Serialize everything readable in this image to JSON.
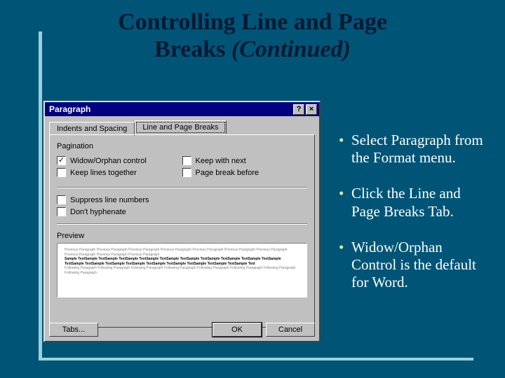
{
  "slide": {
    "title_line1": "Controlling Line and Page",
    "title_line2_a": "Breaks ",
    "title_line2_b": "(Continued)"
  },
  "dialog": {
    "title": "Paragraph",
    "help": "?",
    "close": "×",
    "tab_indents": "Indents and Spacing",
    "tab_breaks": "Line and Page Breaks",
    "section_pagination": "Pagination",
    "chk_widow": "Widow/Orphan control",
    "chk_keepnext": "Keep with next",
    "chk_keeplines": "Keep lines together",
    "chk_pagebreak": "Page break before",
    "chk_suppress": "Suppress line numbers",
    "chk_hyphen": "Don't hyphenate",
    "preview_label": "Preview",
    "preview_grey1": "Previous Paragraph Previous Paragraph Previous Paragraph Previous Paragraph Previous Paragraph Previous Paragraph Previous Paragraph Previous Paragraph Previous Paragraph Previous Paragraph",
    "preview_dark": "Sample TextSample TextSample TextSample TextSample TextSample TextSample TextSample TextSample TextSample TextSample TextSample TextSample TextSample TextSample TextSample TextSample TextSample TextSample TextSample Text",
    "preview_grey2": "Following Paragraph Following Paragraph Following Paragraph Following Paragraph Following Paragraph Following Paragraph Following Paragraph Following Paragraph",
    "btn_tabs": "Tabs...",
    "btn_ok": "OK",
    "btn_cancel": "Cancel"
  },
  "bullets": {
    "b1": "Select Paragraph from the Format menu.",
    "b2": "Click the Line and Page Breaks Tab.",
    "b3": "Widow/Orphan Control is the default for Word."
  }
}
